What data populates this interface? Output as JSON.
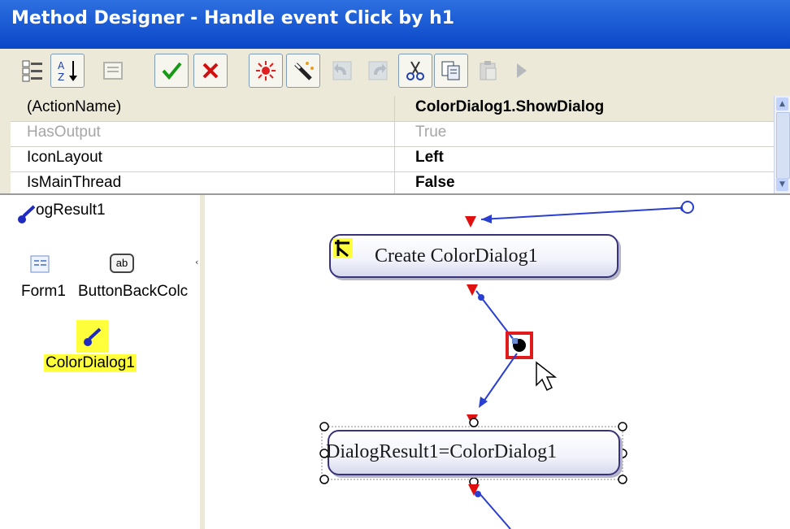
{
  "window": {
    "title": "Method Designer - Handle event Click by h1"
  },
  "toolbar": {
    "buttons": [
      {
        "icon": "categorized-icon"
      },
      {
        "icon": "sort-alpha-icon"
      },
      {
        "icon": "property-pages-icon"
      },
      {
        "icon": "check-icon"
      },
      {
        "icon": "cancel-icon"
      },
      {
        "icon": "debug-icon"
      },
      {
        "icon": "magic-wand-icon"
      },
      {
        "icon": "undo-icon"
      },
      {
        "icon": "redo-icon"
      },
      {
        "icon": "cut-icon"
      },
      {
        "icon": "copy-icon"
      },
      {
        "icon": "paste-icon"
      },
      {
        "icon": "run-icon"
      }
    ]
  },
  "properties": {
    "rows": [
      {
        "name": "(ActionName)",
        "value": "ColorDialog1.ShowDialog"
      },
      {
        "name": "HasOutput",
        "value": "True"
      },
      {
        "name": "IconLayout",
        "value": "Left"
      },
      {
        "name": "IsMainThread",
        "value": "False"
      }
    ]
  },
  "components": {
    "top_item": "ogResult1",
    "form": "Form1",
    "button": "ButtonBackColc",
    "dialog": "ColorDialog1",
    "button_icon_text": "ab"
  },
  "flow": {
    "node1": "Create ColorDialog1",
    "node2": "DialogResult1=ColorDialog1"
  },
  "colors": {
    "title_bar": "#1f5fd6",
    "link_line": "#2a3fd0",
    "arrow_red": "#e01010",
    "selection_highlight": "#ffff3c",
    "selected_port": "#e01b1b"
  }
}
